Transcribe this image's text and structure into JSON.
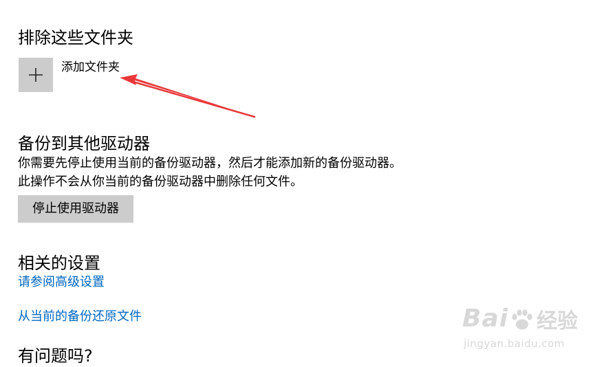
{
  "exclude": {
    "title": "排除这些文件夹",
    "add_icon": "plus-icon",
    "add_label": "添加文件夹"
  },
  "backup_other": {
    "title": "备份到其他驱动器",
    "description": "你需要先停止使用当前的备份驱动器，然后才能添加新的备份驱动器。此操作不会从你当前的备份驱动器中删除任何文件。",
    "stop_button": "停止使用驱动器"
  },
  "related": {
    "title": "相关的设置",
    "advanced_link": "请参阅高级设置",
    "restore_link": "从当前的备份还原文件"
  },
  "help": {
    "title": "有问题吗?"
  },
  "annotation": {
    "arrow_icon": "red-arrow-annotation",
    "color": "#e8383a"
  },
  "watermark": {
    "brand": "Bai",
    "brand_icon": "paw-icon",
    "suffix": "经验",
    "url": "jingyan.baidu.com"
  },
  "colors": {
    "link": "#0067c0",
    "button": "#cccccc"
  }
}
